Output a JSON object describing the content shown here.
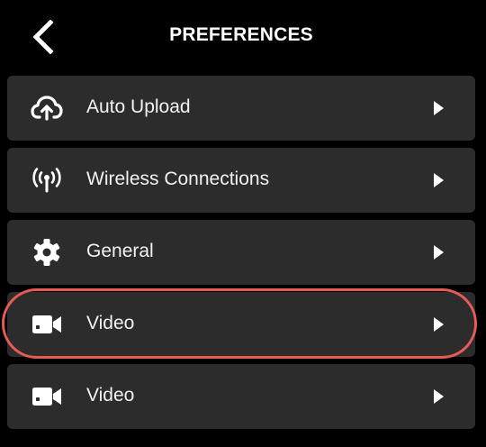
{
  "header": {
    "title": "PREFERENCES",
    "back_icon": "chevron-left-icon"
  },
  "menu": {
    "items": [
      {
        "label": "Auto Upload",
        "icon": "cloud-upload-icon"
      },
      {
        "label": "Wireless Connections",
        "icon": "wireless-antenna-icon"
      },
      {
        "label": "General",
        "icon": "gear-icon"
      },
      {
        "label": "Video",
        "icon": "video-camera-icon"
      },
      {
        "label": "Video",
        "icon": "video-camera-icon"
      }
    ],
    "arrow_icon": "play-arrow-icon"
  },
  "colors": {
    "background": "#000000",
    "item_background": "#2c2c2c",
    "text": "#ffffff",
    "highlight": "#e85a55"
  }
}
